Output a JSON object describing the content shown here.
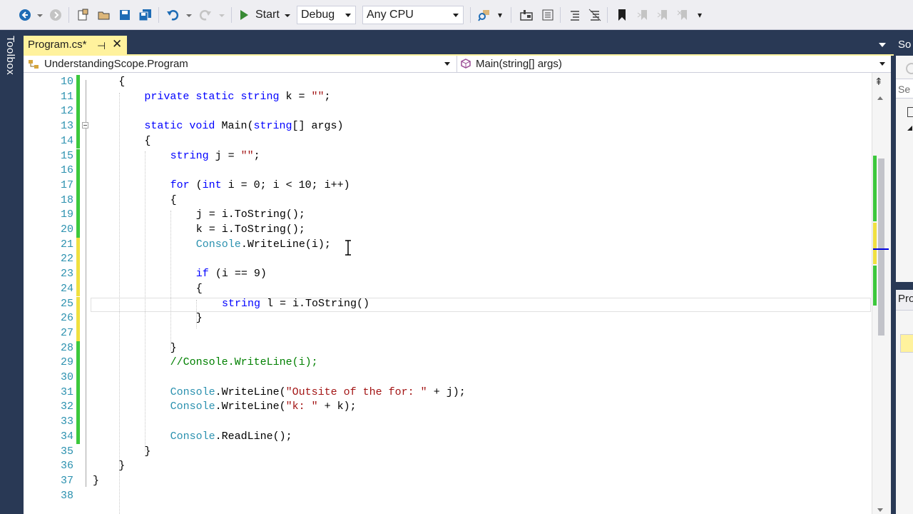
{
  "toolbar": {
    "start_label": "Start",
    "configuration": "Debug",
    "platform": "Any CPU"
  },
  "toolbox": {
    "label": "Toolbox"
  },
  "document_tab": {
    "title": "Program.cs*"
  },
  "navbar": {
    "type_scope": "UnderstandingScope.Program",
    "member_scope": "Main(string[] args)"
  },
  "solution_explorer": {
    "title": "So",
    "search_placeholder": "Se"
  },
  "properties": {
    "title": "Pro"
  },
  "editor": {
    "lines": [
      {
        "n": "10",
        "indent": 2,
        "change": "green",
        "tokens": [
          [
            "p",
            "{"
          ]
        ]
      },
      {
        "n": "11",
        "indent": 3,
        "change": "green",
        "tokens": [
          [
            "k",
            "private"
          ],
          [
            "p",
            " "
          ],
          [
            "k",
            "static"
          ],
          [
            "p",
            " "
          ],
          [
            "k",
            "string"
          ],
          [
            "p",
            " k = "
          ],
          [
            "s",
            "\"\""
          ],
          [
            "p",
            ";"
          ]
        ]
      },
      {
        "n": "12",
        "indent": 0,
        "change": "green",
        "tokens": []
      },
      {
        "n": "13",
        "indent": 3,
        "change": "green",
        "tokens": [
          [
            "k",
            "static"
          ],
          [
            "p",
            " "
          ],
          [
            "k",
            "void"
          ],
          [
            "p",
            " Main("
          ],
          [
            "k",
            "string"
          ],
          [
            "p",
            "[] args)"
          ]
        ]
      },
      {
        "n": "14",
        "indent": 3,
        "change": "green",
        "tokens": [
          [
            "p",
            "{"
          ]
        ]
      },
      {
        "n": "15",
        "indent": 4,
        "change": "green",
        "tokens": [
          [
            "k",
            "string"
          ],
          [
            "p",
            " j = "
          ],
          [
            "s",
            "\"\""
          ],
          [
            "p",
            ";"
          ]
        ]
      },
      {
        "n": "16",
        "indent": 0,
        "change": "green",
        "tokens": []
      },
      {
        "n": "17",
        "indent": 4,
        "change": "green",
        "tokens": [
          [
            "k",
            "for"
          ],
          [
            "p",
            " ("
          ],
          [
            "k",
            "int"
          ],
          [
            "p",
            " i = 0; i < 10; i++)"
          ]
        ]
      },
      {
        "n": "18",
        "indent": 4,
        "change": "green",
        "tokens": [
          [
            "p",
            "{"
          ]
        ]
      },
      {
        "n": "19",
        "indent": 5,
        "change": "green",
        "tokens": [
          [
            "p",
            "j = i.ToString();"
          ]
        ]
      },
      {
        "n": "20",
        "indent": 5,
        "change": "green",
        "tokens": [
          [
            "p",
            "k = i.ToString();"
          ]
        ]
      },
      {
        "n": "21",
        "indent": 5,
        "change": "yellow",
        "tokens": [
          [
            "t",
            "Console"
          ],
          [
            "p",
            ".WriteLine(i);"
          ]
        ]
      },
      {
        "n": "22",
        "indent": 0,
        "change": "yellow",
        "tokens": []
      },
      {
        "n": "23",
        "indent": 5,
        "change": "yellow",
        "tokens": [
          [
            "k",
            "if"
          ],
          [
            "p",
            " (i == 9)"
          ]
        ]
      },
      {
        "n": "24",
        "indent": 5,
        "change": "yellow",
        "tokens": [
          [
            "p",
            "{"
          ]
        ]
      },
      {
        "n": "25",
        "indent": 6,
        "change": "yellow",
        "tokens": [
          [
            "k",
            "string"
          ],
          [
            "p",
            " l = i.ToString()"
          ]
        ]
      },
      {
        "n": "26",
        "indent": 5,
        "change": "yellow",
        "tokens": [
          [
            "p",
            "}"
          ]
        ]
      },
      {
        "n": "27",
        "indent": 0,
        "change": "yellow",
        "tokens": []
      },
      {
        "n": "28",
        "indent": 4,
        "change": "green",
        "tokens": [
          [
            "p",
            "}"
          ]
        ]
      },
      {
        "n": "29",
        "indent": 4,
        "change": "green",
        "tokens": [
          [
            "c",
            "//Console.WriteLine(i);"
          ]
        ]
      },
      {
        "n": "30",
        "indent": 0,
        "change": "green",
        "tokens": []
      },
      {
        "n": "31",
        "indent": 4,
        "change": "green",
        "tokens": [
          [
            "t",
            "Console"
          ],
          [
            "p",
            ".WriteLine("
          ],
          [
            "s",
            "\"Outsite of the for: \""
          ],
          [
            "p",
            " + j);"
          ]
        ]
      },
      {
        "n": "32",
        "indent": 4,
        "change": "green",
        "tokens": [
          [
            "t",
            "Console"
          ],
          [
            "p",
            ".WriteLine("
          ],
          [
            "s",
            "\"k: \""
          ],
          [
            "p",
            " + k);"
          ]
        ]
      },
      {
        "n": "33",
        "indent": 0,
        "change": "green",
        "tokens": []
      },
      {
        "n": "34",
        "indent": 4,
        "change": "green",
        "tokens": [
          [
            "t",
            "Console"
          ],
          [
            "p",
            ".ReadLine();"
          ]
        ]
      },
      {
        "n": "35",
        "indent": 3,
        "change": "none",
        "tokens": [
          [
            "p",
            "}"
          ]
        ]
      },
      {
        "n": "36",
        "indent": 2,
        "change": "none",
        "tokens": [
          [
            "p",
            "}"
          ]
        ]
      },
      {
        "n": "37",
        "indent": 0,
        "change": "none",
        "tokens": [
          [
            "p",
            "}"
          ]
        ]
      },
      {
        "n": "38",
        "indent": 0,
        "change": "none",
        "tokens": []
      }
    ]
  },
  "colors": {
    "keyword": "#0000FF",
    "type": "#2B91AF",
    "string": "#A31515",
    "comment": "#008000",
    "line_number": "#2B91AF",
    "change_saved": "#3CC83C",
    "change_unsaved": "#F0E040",
    "active_tab": "#FFF29D",
    "chrome": "#293955"
  }
}
